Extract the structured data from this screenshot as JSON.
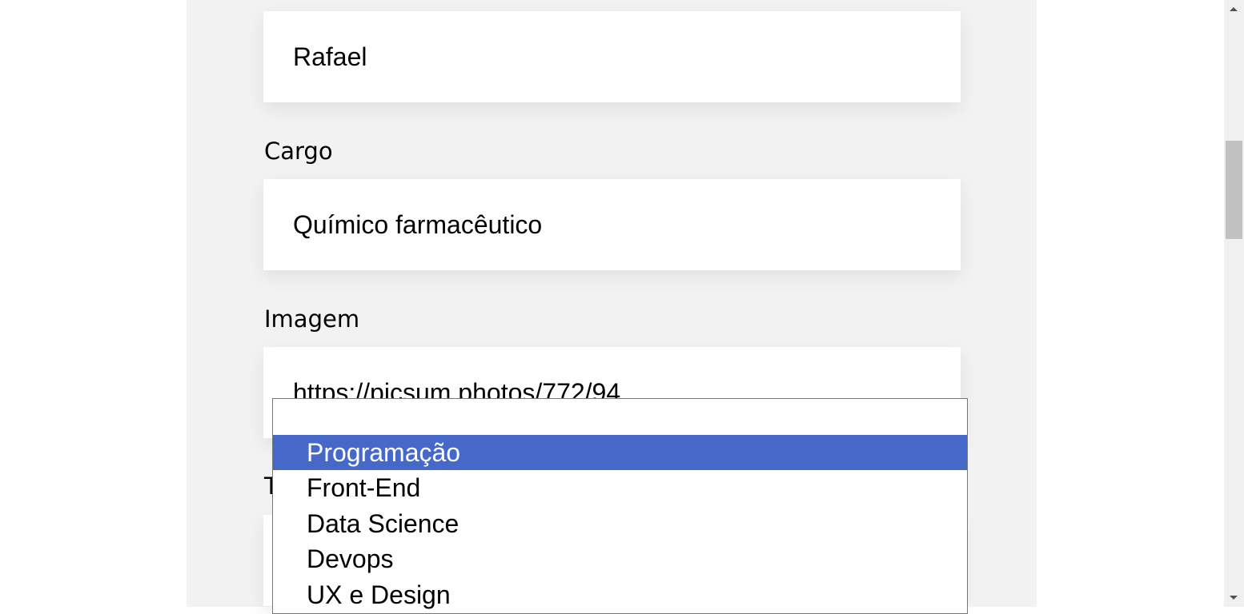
{
  "form": {
    "name_value": "Rafael",
    "cargo_label": "Cargo",
    "cargo_value": "Químico farmacêutico",
    "imagem_label": "Imagem",
    "imagem_value": "https://picsum.photos/772/94",
    "time_label": "T"
  },
  "dropdown": {
    "options": [
      {
        "label": ""
      },
      {
        "label": "Programação",
        "highlighted": true
      },
      {
        "label": "Front-End"
      },
      {
        "label": "Data Science"
      },
      {
        "label": "Devops"
      },
      {
        "label": "UX e Design"
      }
    ],
    "highlight_color": "#4668c9"
  }
}
